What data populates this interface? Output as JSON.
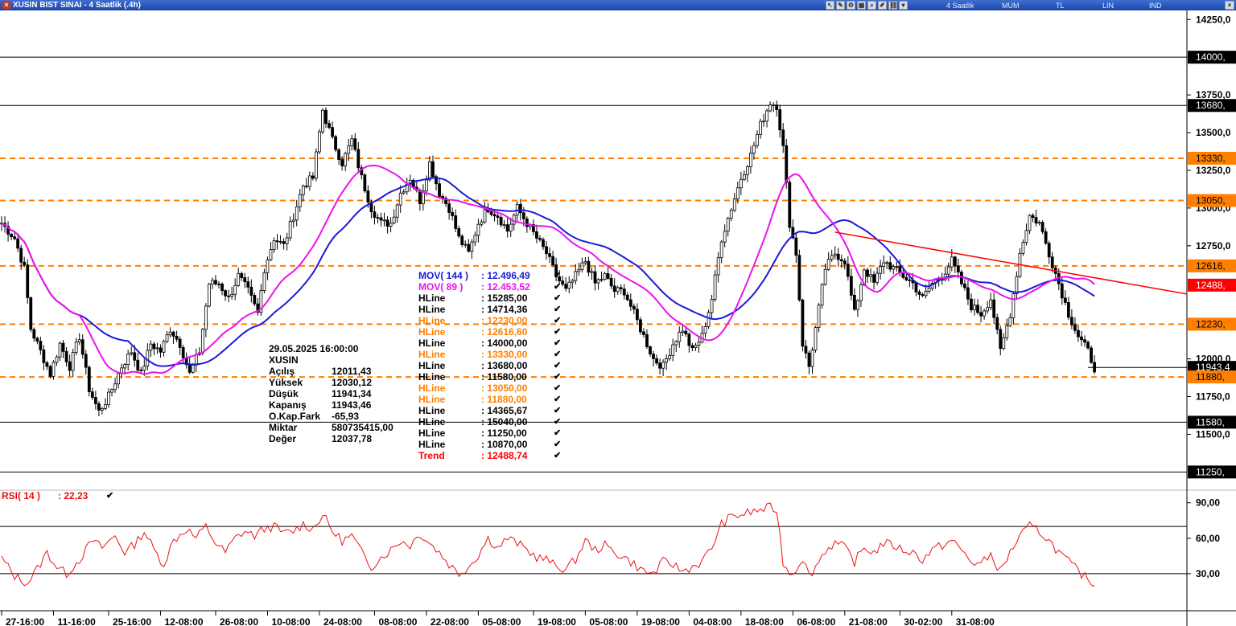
{
  "window": {
    "title": "XUSIN BIST SINAI - 4 Saatlik (.4h)",
    "close_icon": "close-icon"
  },
  "toolbar": {
    "period": "4 Saatlik",
    "chart_style": "MUM",
    "currency": "TL",
    "scale": "LIN",
    "indicator": "IND"
  },
  "colors": {
    "mov144": "#1a1ad8",
    "mov89": "#ee11ee",
    "hline_black": "#000000",
    "hline_orange": "#ff7f00",
    "trend": "#ff0000",
    "rsi": "#ee1111",
    "candle": "#000000"
  },
  "ohlc_panel": {
    "datetime": "29.05.2025  16:00:00",
    "symbol": "XUSIN",
    "rows": [
      {
        "label": "Açılış",
        "value": "12011,43"
      },
      {
        "label": "Yüksek",
        "value": "12030,12"
      },
      {
        "label": "Düşük",
        "value": "11941,34"
      },
      {
        "label": "Kapanış",
        "value": "11943,46"
      },
      {
        "label": "O.Kap.Fark",
        "value": "-65,93"
      },
      {
        "label": "Miktar",
        "value": "580735415,00"
      },
      {
        "label": "Değer",
        "value": "12037,78"
      }
    ]
  },
  "legend": [
    {
      "label": "MOV( 144 )",
      "value": ": 12.496,49",
      "color": "#1a1ad8"
    },
    {
      "label": "MOV( 89 )",
      "value": ": 12.453,52",
      "color": "#ee11ee"
    },
    {
      "label": "HLine",
      "value": ": 15285,00",
      "color": "#000000"
    },
    {
      "label": "HLine",
      "value": ": 14714,36",
      "color": "#000000"
    },
    {
      "label": "HLine",
      "value": ": 12230,00",
      "color": "#ff7f00"
    },
    {
      "label": "HLine",
      "value": ": 12616,60",
      "color": "#ff7f00"
    },
    {
      "label": "HLine",
      "value": ": 14000,00",
      "color": "#000000"
    },
    {
      "label": "HLine",
      "value": ": 13330,00",
      "color": "#ff7f00"
    },
    {
      "label": "HLine",
      "value": ": 13680,00",
      "color": "#000000"
    },
    {
      "label": "HLine",
      "value": ": 11580,00",
      "color": "#000000"
    },
    {
      "label": "HLine",
      "value": ": 13050,00",
      "color": "#ff7f00"
    },
    {
      "label": "HLine",
      "value": ": 11880,00",
      "color": "#ff7f00"
    },
    {
      "label": "HLine",
      "value": ": 14365,67",
      "color": "#000000"
    },
    {
      "label": "HLine",
      "value": ": 15040,00",
      "color": "#000000"
    },
    {
      "label": "HLine",
      "value": ": 11250,00",
      "color": "#000000"
    },
    {
      "label": "HLine",
      "value": ": 10870,00",
      "color": "#000000"
    },
    {
      "label": "Trend",
      "value": ": 12488,74",
      "color": "#ff0000"
    }
  ],
  "rsi_panel": {
    "label": "RSI( 14 )",
    "value": ": 22,23"
  },
  "chart_data": [
    {
      "type": "candlestick",
      "ylim": [
        11140,
        14310
      ],
      "yticks": [
        {
          "value": 14250,
          "label": "14250,0"
        },
        {
          "value": 13750,
          "label": "13750,0"
        },
        {
          "value": 13500,
          "label": "13500,0"
        },
        {
          "value": 13250,
          "label": "13250,0"
        },
        {
          "value": 13000,
          "label": "13000,0"
        },
        {
          "value": 12750,
          "label": "12750,0"
        },
        {
          "value": 12000,
          "label": "12000,0"
        },
        {
          "value": 11750,
          "label": "11750,0"
        },
        {
          "value": 11500,
          "label": "11500,0"
        }
      ],
      "price_tags": [
        {
          "value": 14000,
          "label": "14000,",
          "kind": "black"
        },
        {
          "value": 13680,
          "label": "13680,",
          "kind": "black"
        },
        {
          "value": 13330,
          "label": "13330,",
          "kind": "orange"
        },
        {
          "value": 13050,
          "label": "13050,",
          "kind": "orange"
        },
        {
          "value": 12616.6,
          "label": "12616,",
          "kind": "orange"
        },
        {
          "value": 12488.74,
          "label": "12488,",
          "kind": "red"
        },
        {
          "value": 12230,
          "label": "12230,",
          "kind": "orange"
        },
        {
          "value": 11943.46,
          "label": "11943,4",
          "kind": "black"
        },
        {
          "value": 11880,
          "label": "11880,",
          "kind": "orange"
        },
        {
          "value": 11580,
          "label": "11580,",
          "kind": "black"
        },
        {
          "value": 11250,
          "label": "11250,",
          "kind": "black"
        }
      ],
      "hlines": [
        {
          "value": 14000,
          "style": "solid",
          "color": "#000000"
        },
        {
          "value": 13680,
          "style": "solid",
          "color": "#000000"
        },
        {
          "value": 11580,
          "style": "solid",
          "color": "#000000"
        },
        {
          "value": 11250,
          "style": "solid",
          "color": "#000000"
        },
        {
          "value": 13330,
          "style": "dashed",
          "color": "#ff7f00"
        },
        {
          "value": 13050,
          "style": "dashed",
          "color": "#ff7f00"
        },
        {
          "value": 12616.6,
          "style": "dashed",
          "color": "#ff7f00"
        },
        {
          "value": 12230,
          "style": "dashed",
          "color": "#ff7f00"
        },
        {
          "value": 11880,
          "style": "dashed",
          "color": "#ff7f00"
        }
      ],
      "anchors": [
        [
          0,
          12900
        ],
        [
          4,
          12800
        ],
        [
          7,
          12600
        ],
        [
          9,
          12200
        ],
        [
          12,
          12050
        ],
        [
          15,
          11900
        ],
        [
          18,
          12100
        ],
        [
          21,
          11950
        ],
        [
          24,
          12150
        ],
        [
          27,
          11800
        ],
        [
          30,
          11650
        ],
        [
          33,
          11750
        ],
        [
          37,
          11950
        ],
        [
          40,
          12050
        ],
        [
          43,
          11900
        ],
        [
          46,
          12100
        ],
        [
          49,
          12050
        ],
        [
          52,
          12200
        ],
        [
          55,
          12100
        ],
        [
          58,
          11900
        ],
        [
          61,
          12050
        ],
        [
          64,
          12500
        ],
        [
          67,
          12500
        ],
        [
          70,
          12400
        ],
        [
          73,
          12550
        ],
        [
          76,
          12450
        ],
        [
          79,
          12300
        ],
        [
          81,
          12600
        ],
        [
          84,
          12800
        ],
        [
          87,
          12750
        ],
        [
          90,
          12950
        ],
        [
          93,
          13150
        ],
        [
          96,
          13200
        ],
        [
          99,
          13650
        ],
        [
          102,
          13450
        ],
        [
          105,
          13300
        ],
        [
          108,
          13450
        ],
        [
          111,
          13200
        ],
        [
          114,
          13000
        ],
        [
          117,
          12900
        ],
        [
          120,
          12900
        ],
        [
          123,
          13100
        ],
        [
          126,
          13200
        ],
        [
          129,
          13050
        ],
        [
          132,
          13300
        ],
        [
          135,
          13100
        ],
        [
          138,
          13000
        ],
        [
          141,
          12800
        ],
        [
          144,
          12700
        ],
        [
          147,
          12900
        ],
        [
          150,
          13000
        ],
        [
          153,
          12950
        ],
        [
          156,
          12850
        ],
        [
          159,
          13000
        ],
        [
          162,
          12900
        ],
        [
          165,
          12800
        ],
        [
          168,
          12700
        ],
        [
          171,
          12550
        ],
        [
          174,
          12450
        ],
        [
          177,
          12550
        ],
        [
          180,
          12650
        ],
        [
          183,
          12500
        ],
        [
          186,
          12550
        ],
        [
          189,
          12450
        ],
        [
          192,
          12450
        ],
        [
          195,
          12300
        ],
        [
          198,
          12150
        ],
        [
          201,
          12000
        ],
        [
          204,
          11950
        ],
        [
          207,
          12100
        ],
        [
          210,
          12200
        ],
        [
          213,
          12050
        ],
        [
          216,
          12150
        ],
        [
          219,
          12400
        ],
        [
          222,
          12800
        ],
        [
          225,
          13000
        ],
        [
          228,
          13200
        ],
        [
          231,
          13350
        ],
        [
          234,
          13550
        ],
        [
          237,
          13700
        ],
        [
          239,
          13680
        ],
        [
          241,
          13400
        ],
        [
          243,
          12900
        ],
        [
          245,
          12700
        ],
        [
          247,
          12100
        ],
        [
          249,
          11950
        ],
        [
          251,
          12200
        ],
        [
          254,
          12600
        ],
        [
          257,
          12700
        ],
        [
          260,
          12650
        ],
        [
          263,
          12300
        ],
        [
          266,
          12600
        ],
        [
          269,
          12500
        ],
        [
          272,
          12650
        ],
        [
          275,
          12600
        ],
        [
          278,
          12550
        ],
        [
          281,
          12500
        ],
        [
          284,
          12400
        ],
        [
          287,
          12500
        ],
        [
          290,
          12550
        ],
        [
          293,
          12650
        ],
        [
          296,
          12500
        ],
        [
          299,
          12350
        ],
        [
          302,
          12300
        ],
        [
          305,
          12400
        ],
        [
          308,
          12050
        ],
        [
          311,
          12300
        ],
        [
          314,
          12700
        ],
        [
          317,
          12950
        ],
        [
          320,
          12900
        ],
        [
          323,
          12700
        ],
        [
          326,
          12500
        ],
        [
          329,
          12300
        ],
        [
          332,
          12150
        ],
        [
          335,
          12050
        ],
        [
          337,
          11943
        ]
      ],
      "rsi": {
        "ylim": [
          0,
          100
        ],
        "yticks": [
          {
            "value": 90,
            "label": "90,00"
          },
          {
            "value": 60,
            "label": "60,00"
          },
          {
            "value": 30,
            "label": "30,00"
          }
        ],
        "levels": [
          70,
          30
        ],
        "anchors": [
          [
            0,
            43
          ],
          [
            4,
            28
          ],
          [
            8,
            22
          ],
          [
            11,
            34
          ],
          [
            14,
            48
          ],
          [
            17,
            36
          ],
          [
            20,
            30
          ],
          [
            24,
            42
          ],
          [
            28,
            58
          ],
          [
            31,
            52
          ],
          [
            35,
            62
          ],
          [
            38,
            48
          ],
          [
            41,
            55
          ],
          [
            44,
            66
          ],
          [
            47,
            50
          ],
          [
            50,
            38
          ],
          [
            53,
            58
          ],
          [
            57,
            68
          ],
          [
            60,
            60
          ],
          [
            63,
            70
          ],
          [
            66,
            56
          ],
          [
            69,
            48
          ],
          [
            72,
            60
          ],
          [
            75,
            66
          ],
          [
            78,
            62
          ],
          [
            81,
            68
          ],
          [
            84,
            70
          ],
          [
            87,
            64
          ],
          [
            90,
            66
          ],
          [
            93,
            72
          ],
          [
            96,
            68
          ],
          [
            99,
            80
          ],
          [
            102,
            66
          ],
          [
            105,
            58
          ],
          [
            108,
            62
          ],
          [
            111,
            48
          ],
          [
            114,
            36
          ],
          [
            117,
            44
          ],
          [
            120,
            50
          ],
          [
            123,
            58
          ],
          [
            126,
            54
          ],
          [
            129,
            64
          ],
          [
            132,
            56
          ],
          [
            135,
            48
          ],
          [
            138,
            38
          ],
          [
            141,
            30
          ],
          [
            144,
            36
          ],
          [
            147,
            46
          ],
          [
            150,
            60
          ],
          [
            153,
            52
          ],
          [
            156,
            60
          ],
          [
            159,
            56
          ],
          [
            162,
            50
          ],
          [
            165,
            44
          ],
          [
            168,
            42
          ],
          [
            171,
            36
          ],
          [
            174,
            34
          ],
          [
            177,
            42
          ],
          [
            180,
            58
          ],
          [
            183,
            50
          ],
          [
            186,
            54
          ],
          [
            189,
            48
          ],
          [
            192,
            44
          ],
          [
            195,
            38
          ],
          [
            198,
            32
          ],
          [
            201,
            30
          ],
          [
            204,
            40
          ],
          [
            207,
            38
          ],
          [
            210,
            32
          ],
          [
            213,
            36
          ],
          [
            216,
            40
          ],
          [
            219,
            52
          ],
          [
            222,
            72
          ],
          [
            225,
            78
          ],
          [
            228,
            80
          ],
          [
            231,
            82
          ],
          [
            234,
            84
          ],
          [
            237,
            86
          ],
          [
            239,
            84
          ],
          [
            241,
            40
          ],
          [
            243,
            30
          ],
          [
            245,
            34
          ],
          [
            247,
            44
          ],
          [
            249,
            28
          ],
          [
            251,
            36
          ],
          [
            254,
            50
          ],
          [
            257,
            56
          ],
          [
            260,
            52
          ],
          [
            263,
            40
          ],
          [
            266,
            52
          ],
          [
            269,
            48
          ],
          [
            272,
            56
          ],
          [
            275,
            54
          ],
          [
            278,
            50
          ],
          [
            281,
            48
          ],
          [
            284,
            42
          ],
          [
            287,
            50
          ],
          [
            290,
            54
          ],
          [
            293,
            58
          ],
          [
            296,
            50
          ],
          [
            299,
            40
          ],
          [
            302,
            38
          ],
          [
            305,
            46
          ],
          [
            308,
            32
          ],
          [
            311,
            48
          ],
          [
            314,
            62
          ],
          [
            317,
            70
          ],
          [
            320,
            66
          ],
          [
            323,
            58
          ],
          [
            326,
            48
          ],
          [
            329,
            40
          ],
          [
            332,
            32
          ],
          [
            335,
            25
          ],
          [
            337,
            22
          ]
        ]
      },
      "x_labels": [
        {
          "bar": 0,
          "label": "27-16:00"
        },
        {
          "bar": 16,
          "label": "11-16:00"
        },
        {
          "bar": 33,
          "label": "25-16:00"
        },
        {
          "bar": 49,
          "label": "12-08:00"
        },
        {
          "bar": 66,
          "label": "26-08:00"
        },
        {
          "bar": 82,
          "label": "10-08:00"
        },
        {
          "bar": 98,
          "label": "24-08:00"
        },
        {
          "bar": 115,
          "label": "08-08:00"
        },
        {
          "bar": 131,
          "label": "22-08:00"
        },
        {
          "bar": 147,
          "label": "05-08:00"
        },
        {
          "bar": 164,
          "label": "19-08:00"
        },
        {
          "bar": 180,
          "label": "05-08:00"
        },
        {
          "bar": 196,
          "label": "19-08:00"
        },
        {
          "bar": 212,
          "label": "04-08:00"
        },
        {
          "bar": 228,
          "label": "18-08:00"
        },
        {
          "bar": 244,
          "label": "06-08:00"
        },
        {
          "bar": 260,
          "label": "21-08:00"
        },
        {
          "bar": 277,
          "label": "30-02:00"
        },
        {
          "bar": 293,
          "label": "31-08:00"
        }
      ]
    }
  ]
}
